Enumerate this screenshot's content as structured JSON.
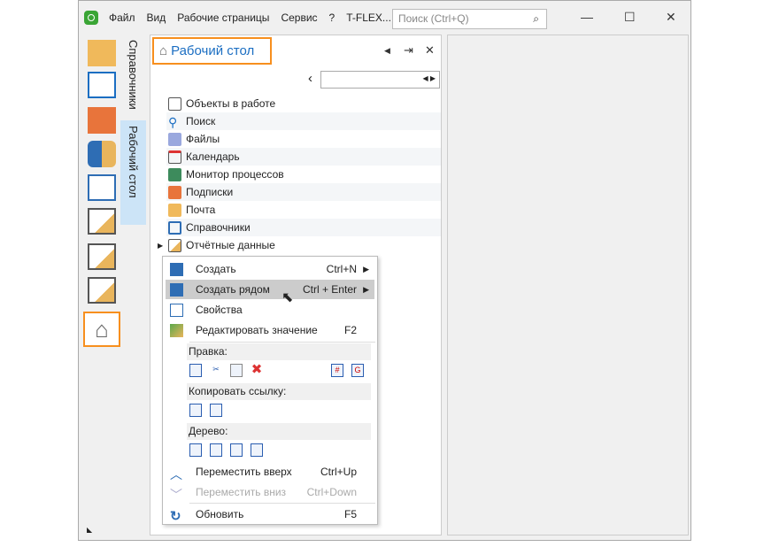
{
  "menubar": {
    "items": [
      "Файл",
      "Вид",
      "Рабочие страницы",
      "Сервис",
      "?",
      "T-FLEX..."
    ],
    "search_placeholder": "Поиск (Ctrl+Q)"
  },
  "vertical_tabs": [
    "Справочники",
    "Рабочий стол"
  ],
  "panel": {
    "title": "Рабочий стол",
    "items": [
      "Объекты в работе",
      "Поиск",
      "Файлы",
      "Календарь",
      "Монитор процессов",
      "Подписки",
      "Почта",
      "Справочники",
      "Отчётные данные"
    ]
  },
  "context_menu": {
    "items": [
      {
        "label": "Создать",
        "shortcut": "Ctrl+N"
      },
      {
        "label": "Создать рядом",
        "shortcut": "Ctrl + Enter"
      },
      {
        "label": "Свойства",
        "shortcut": ""
      },
      {
        "label": "Редактировать значение",
        "shortcut": "F2"
      }
    ],
    "sections": {
      "edit": "Правка:",
      "copy_link": "Копировать ссылку:",
      "tree": "Дерево:"
    },
    "bottom": [
      {
        "label": "Переместить вверх",
        "shortcut": "Ctrl+Up"
      },
      {
        "label": "Переместить вниз",
        "shortcut": "Ctrl+Down"
      },
      {
        "label": "Обновить",
        "shortcut": "F5"
      }
    ]
  },
  "colors": {
    "accent": "#1b6ec2",
    "highlight": "#f78f1e"
  }
}
